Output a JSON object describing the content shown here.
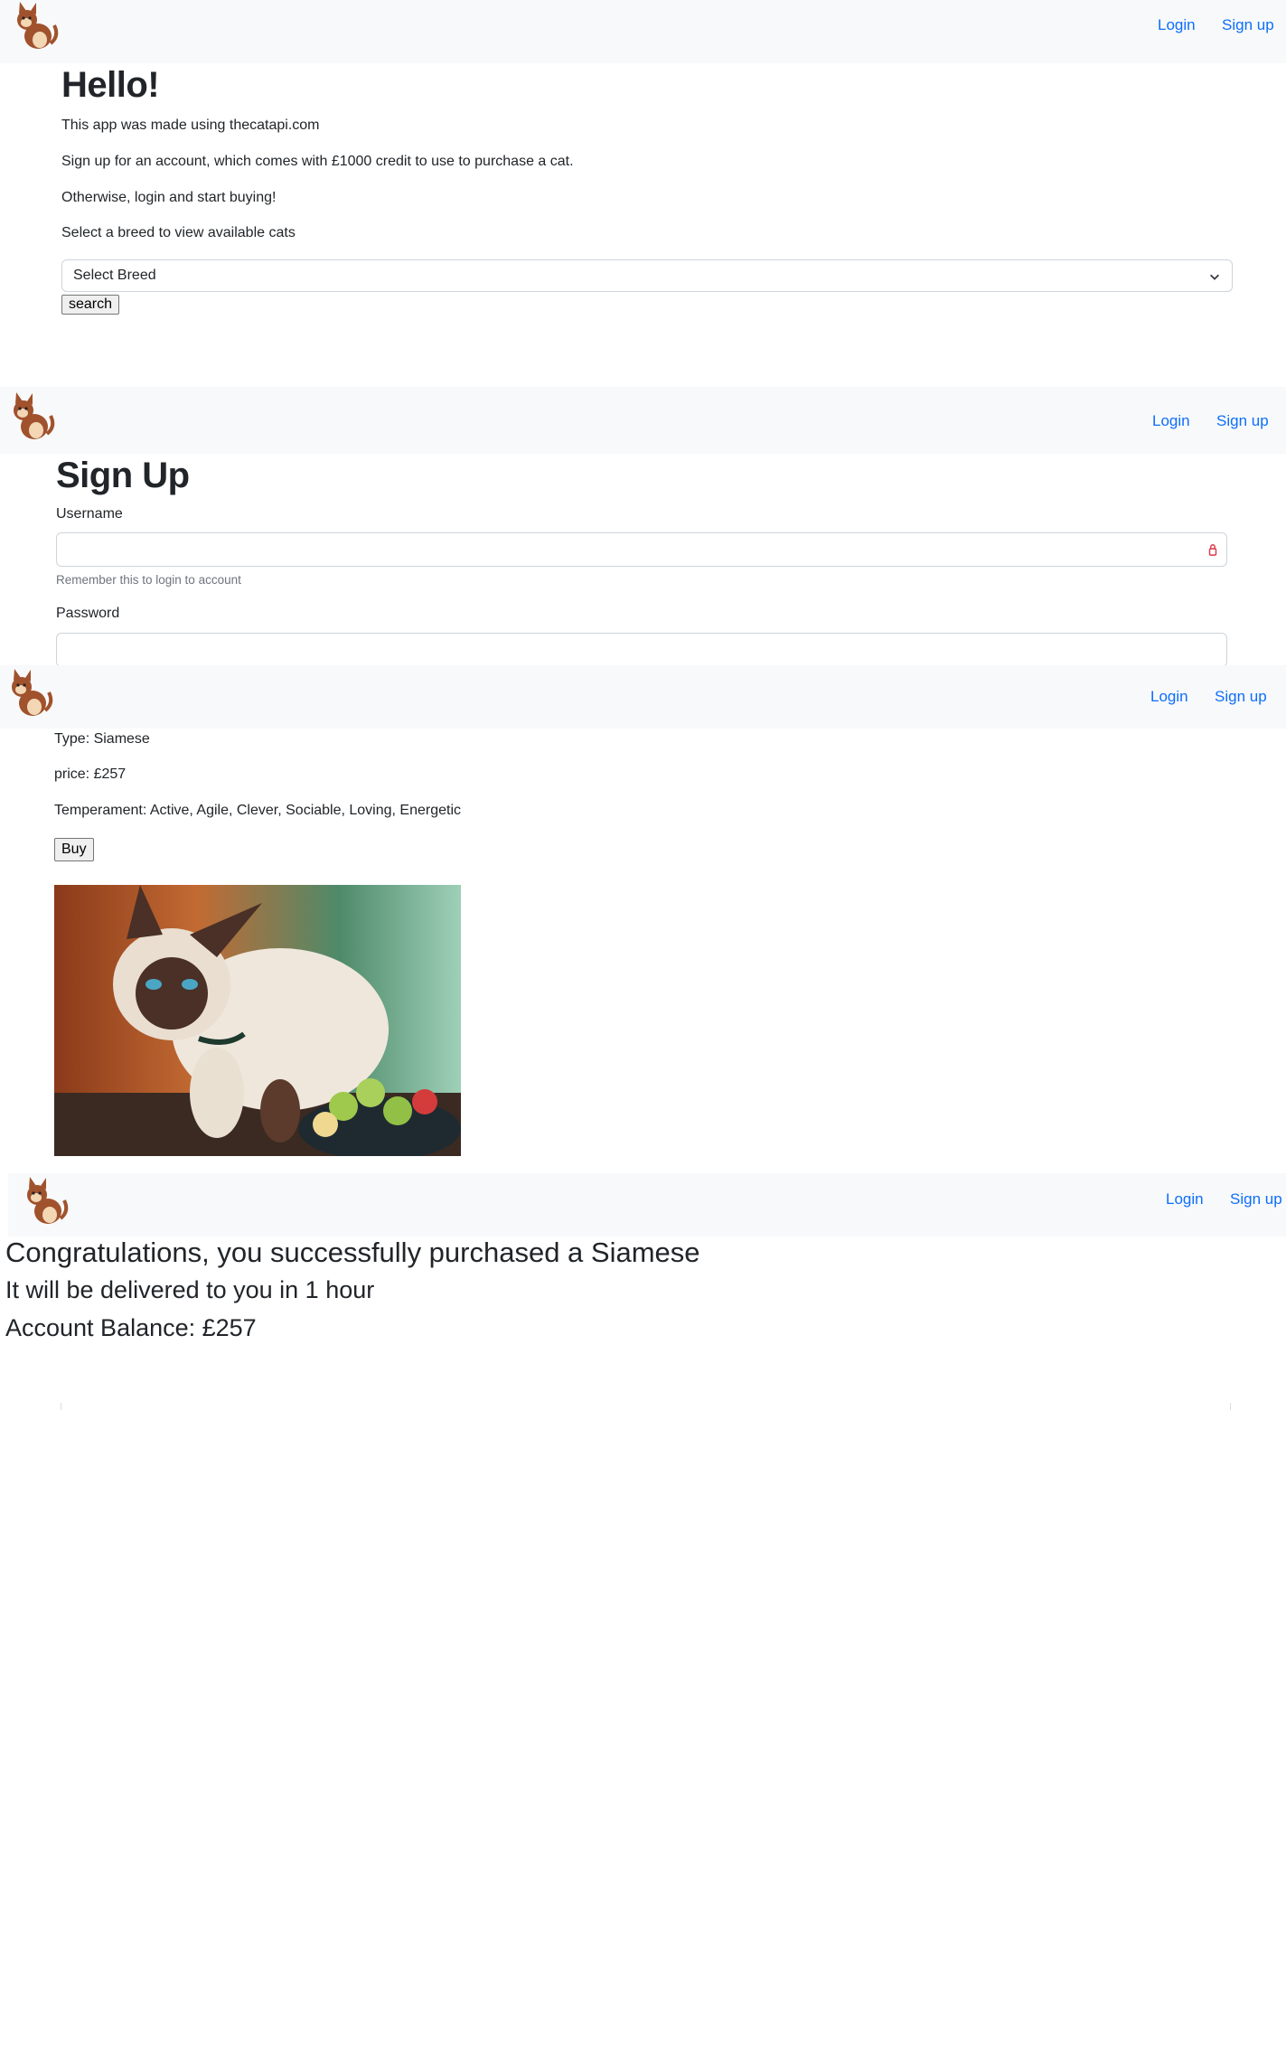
{
  "nav": {
    "login": "Login",
    "signup": "Sign up"
  },
  "home": {
    "title": "Hello!",
    "line1": "This app was made using thecatapi.com",
    "line2": "Sign up for an account, which comes with £1000 credit to use to purchase a cat.",
    "line3": "Otherwise, login and start buying!",
    "line4": "Select a breed to view available cats",
    "select_value": "Select Breed",
    "search_button": "search"
  },
  "signup": {
    "title": "Sign Up",
    "username_label": "Username",
    "username_help": "Remember this to login to account",
    "password_label": "Password"
  },
  "cat": {
    "type": "Type: Siamese",
    "price": "price: £257",
    "temperament": "Temperament: Active, Agile, Clever, Sociable, Loving, Energetic",
    "buy_button": "Buy"
  },
  "success": {
    "line1": "Congratulations, you successfully purchased a Siamese",
    "line2": "It will be delivered to you in 1 hour",
    "line3": "Account Balance: £257"
  },
  "icons": {
    "logo": "cat-logo-icon",
    "dropdown": "chevron-down-icon",
    "password_manager": "key-icon"
  }
}
